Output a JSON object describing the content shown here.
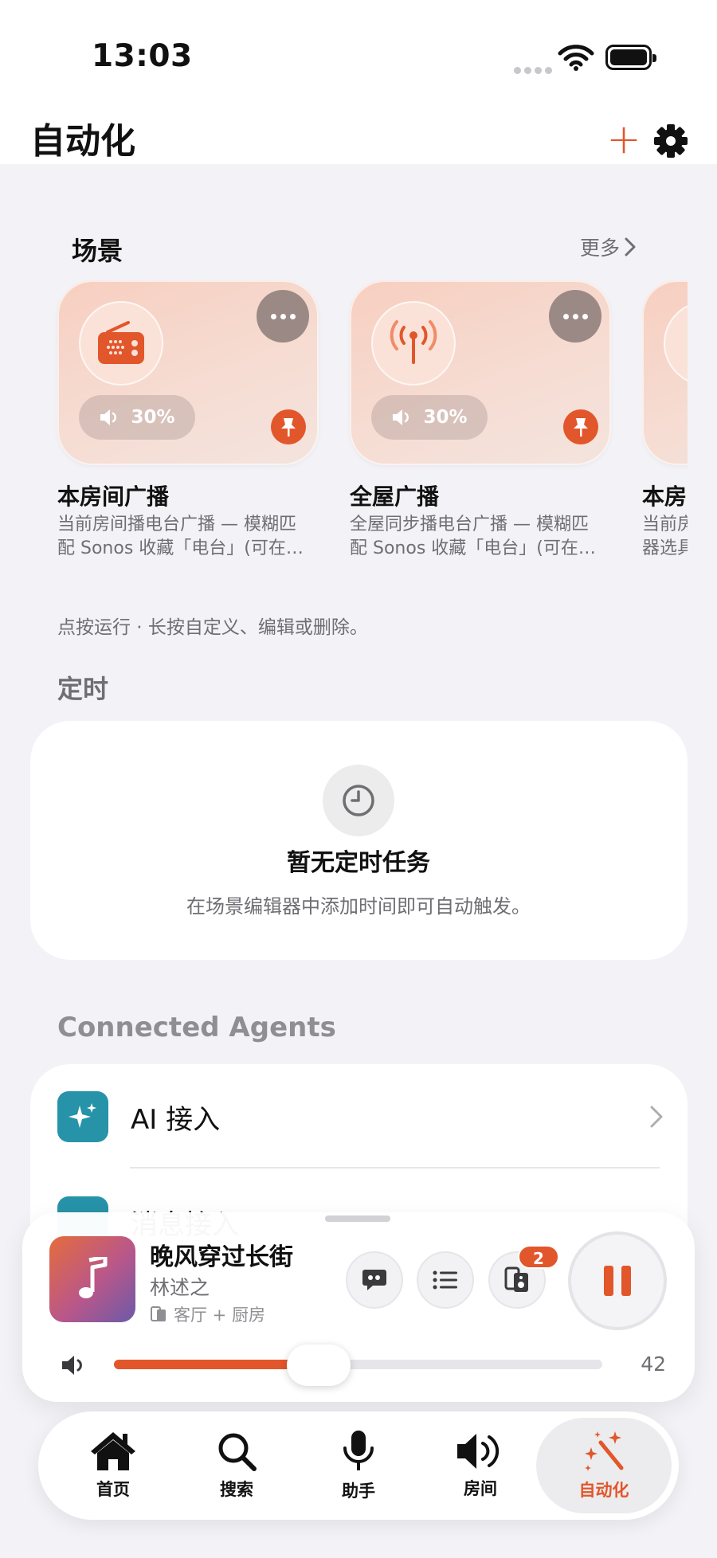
{
  "status_bar": {
    "time": "13:03"
  },
  "header": {
    "title": "自动化"
  },
  "scenes": {
    "section_title": "场景",
    "more_label": "更多",
    "items": [
      {
        "title": "本房间广播",
        "desc_line1": "当前房间播电台广播 — 模糊匹",
        "desc_line2": "配 Sonos 收藏「电台」(可在…",
        "volume": "30%",
        "icon": "radio-icon"
      },
      {
        "title": "全屋广播",
        "desc_line1": "全屋同步播电台广播 — 模糊匹",
        "desc_line2": "配 Sonos 收藏「电台」(可在…",
        "volume": "30%",
        "icon": "antenna-icon"
      },
      {
        "title": "本房",
        "desc_line1": "当前房",
        "desc_line2": "器选具",
        "volume": "",
        "icon": "speaker-icon"
      }
    ],
    "hint": "点按运行 · 长按自定义、编辑或删除。"
  },
  "schedule": {
    "section_title": "定时",
    "empty_title": "暂无定时任务",
    "empty_subtitle": "在场景编辑器中添加时间即可自动触发。"
  },
  "agents": {
    "section_title": "Connected Agents",
    "items": [
      {
        "label": "AI 接入"
      },
      {
        "label": "消息接入"
      }
    ]
  },
  "player": {
    "title": "晚风穿过长街",
    "artist": "林述之",
    "rooms": "客厅 + 厨房",
    "group_count": "2",
    "volume": "42",
    "volume_fraction": 0.42
  },
  "tabs": [
    {
      "label": "首页",
      "icon": "home-icon"
    },
    {
      "label": "搜索",
      "icon": "search-icon"
    },
    {
      "label": "助手",
      "icon": "microphone-icon"
    },
    {
      "label": "房间",
      "icon": "speaker-volume-icon"
    },
    {
      "label": "自动化",
      "icon": "magic-wand-icon",
      "active": true
    }
  ],
  "colors": {
    "accent": "#e2562b",
    "agent_teal": "#2793a8",
    "background": "#f2f2f7"
  }
}
